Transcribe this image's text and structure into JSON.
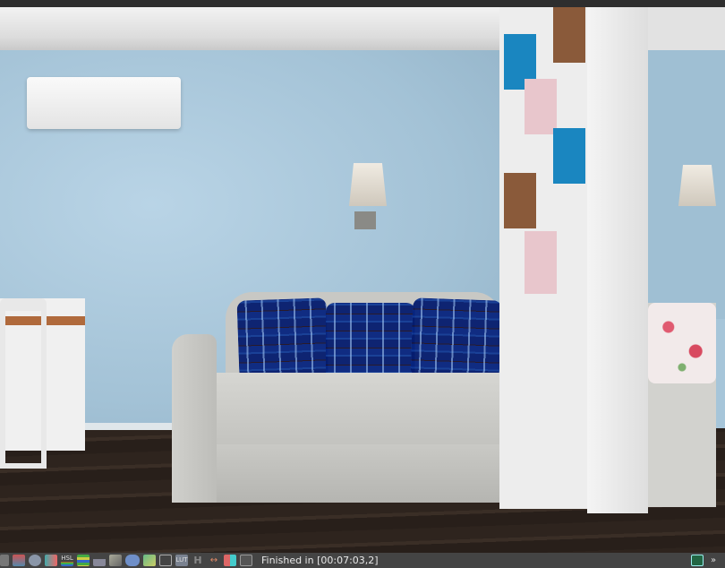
{
  "window": {
    "title": "V-Ray Frame Buffer"
  },
  "status": {
    "text": "Finished in [00:07:03,2]"
  },
  "toolbar": {
    "icons": [
      "layers-icon",
      "stamp-icon",
      "info-icon",
      "exposure-icon",
      "hsl-icon",
      "levels-icon",
      "histogram-icon",
      "white-balance-icon",
      "color-balance-icon",
      "background-image-icon",
      "curves-icon",
      "lut-icon",
      "hue-icon",
      "lens-effects-icon",
      "compare-icon",
      "denoiser-icon"
    ],
    "labels": {
      "hsl": "HSL",
      "lut": "LUT",
      "h": "H"
    },
    "right_icons": [
      "panel-toggle-icon",
      "expand-icon"
    ]
  },
  "colors": {
    "toolbar_bg": "#444444",
    "wall": "#a6c5d9",
    "floor": "#2e241e",
    "pillow": "#2a5cb0"
  }
}
